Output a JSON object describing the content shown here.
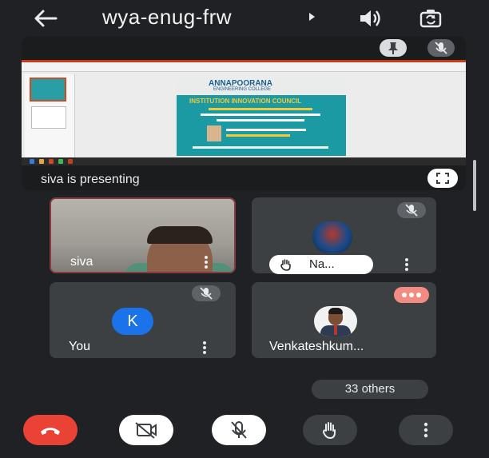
{
  "header": {
    "meeting_code": "wya-enug-frw"
  },
  "presentation": {
    "status_text": "siva is presenting",
    "slide": {
      "college": "ANNAPOORANA",
      "college_sub": "ENGINEERING COLLEGE",
      "council": "INSTITUTION INNOVATION COUNCIL"
    }
  },
  "participants": [
    {
      "name": "siva",
      "has_video": true,
      "muted": false
    },
    {
      "name": "Na...",
      "avatar": "team-logo",
      "muted": true,
      "hand_raised": true
    },
    {
      "name": "You",
      "initial": "K",
      "muted": true
    },
    {
      "name": "Venkateshkum...",
      "avatar": "photo",
      "speaking": true
    }
  ],
  "others_label": "33 others",
  "colors": {
    "background": "#202124",
    "tile": "#3c4043",
    "end_call": "#ea4335",
    "avatar_blue": "#1a73e8",
    "speaking": "#f28b82"
  },
  "controls": [
    "end-call",
    "camera-off",
    "mic-off",
    "raise-hand",
    "more-options"
  ]
}
